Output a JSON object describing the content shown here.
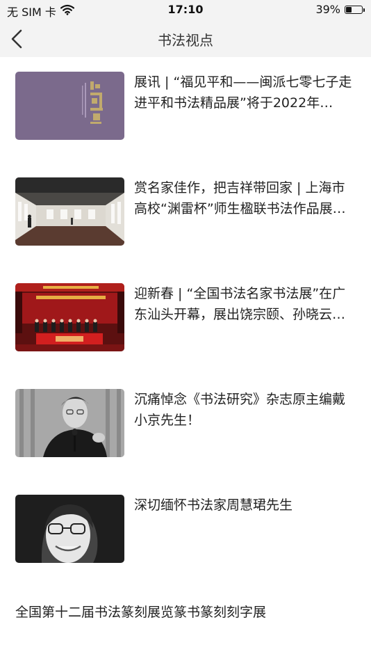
{
  "status_bar": {
    "carrier": "无 SIM 卡",
    "time": "17:10",
    "battery_percent_label": "39%",
    "battery_level": 0.39
  },
  "nav": {
    "title": "书法视点",
    "back_icon": "chevron-left-icon"
  },
  "articles": [
    {
      "title": "展讯 | “福见平和——闽派七零七子走进平和书法精品展”将于2022年…",
      "thumb": "exhibition-poster-thumbnail"
    },
    {
      "title": "赏名家佳作，把吉祥带回家 | 上海市高校“渊雷杯”师生楹联书法作品展…",
      "thumb": "gallery-hall-thumbnail"
    },
    {
      "title": "迎新春 | “全国书法名家书法展”在广东汕头开幕，展出饶宗颐、孙晓云…",
      "thumb": "stage-ceremony-thumbnail"
    },
    {
      "title": "沉痛悼念《书法研究》杂志原主编戴小京先生！",
      "thumb": "portrait-microphone-thumbnail"
    },
    {
      "title": "深切缅怀书法家周慧珺先生",
      "thumb": "portrait-smiling-thumbnail"
    }
  ],
  "text_article": {
    "title": "全国第十二届书法篆刻展览篆书篆刻刻字展"
  },
  "colors": {
    "nav_bg": "#f3f3f3",
    "title_text": "#222222",
    "poster_purple": "#7b6a8c"
  }
}
